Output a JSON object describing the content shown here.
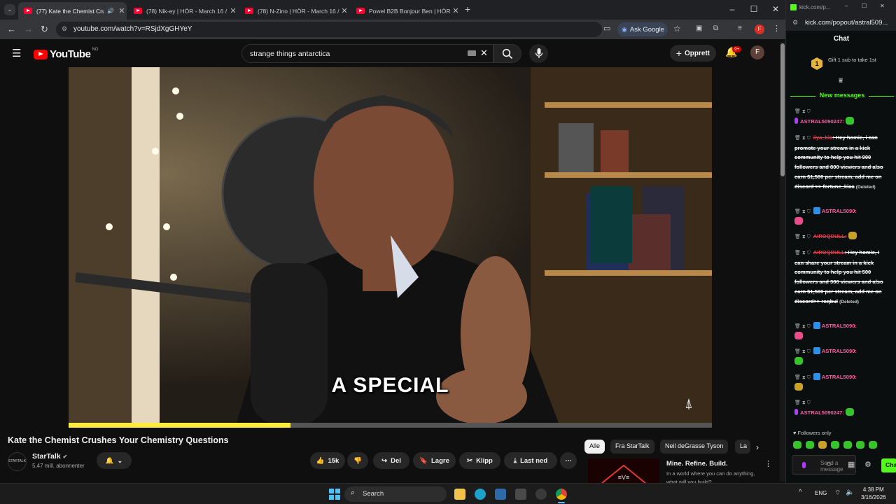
{
  "browser": {
    "tabs": [
      {
        "title": "(77) Kate the Chemist Crush",
        "active": true
      },
      {
        "title": "(78) Nik-ey | HÖR - March 16 /",
        "active": false
      },
      {
        "title": "(78) N-Zino | HÖR - March 16 /",
        "active": false
      },
      {
        "title": "Powel B2B Bonjour Ben | HÖR",
        "active": false
      }
    ],
    "url": "youtube.com/watch?v=RSjdXgGHYeY",
    "ask_google": "Ask Google",
    "profile_initial": "F"
  },
  "youtube": {
    "logo_text": "YouTube",
    "country_code": "NO",
    "search_value": "strange things antarctica",
    "create_label": "Opprett",
    "notif_count": "9+",
    "avatar_initial": "F",
    "video": {
      "caption": "A SPECIAL",
      "progress_fraction": 0.345
    },
    "title": "Kate the Chemist Crushes Your Chemistry Questions",
    "channel": {
      "logo_text": "STARTALK",
      "name": "StarTalk",
      "subscribers": "5,47 mill. abonnenter"
    },
    "actions": {
      "likes": "15k",
      "share": "Del",
      "save": "Lagre",
      "clip": "Klipp",
      "download": "Last ned"
    },
    "chips": [
      "Alle",
      "Fra StarTalk",
      "Neil deGrasse Tyson",
      "La"
    ],
    "recommendation": {
      "title": "Mine. Refine. Build.",
      "description": "In a world where you can do anything, what will you build?"
    }
  },
  "kick": {
    "window_url_short": "kick.com/p...",
    "url": "kick.com/popout/astral509...",
    "header": "Chat",
    "gift_count": "1",
    "gift_text": "Gift 1 sub to take 1st",
    "new_messages_label": "New messages",
    "messages": [
      {
        "user": "ASTRAL5090247:",
        "text": "",
        "deleted": false
      },
      {
        "user": "iiya_kia",
        "text": ": Hey homie, i can promote your stream in a kick community to help you hit 900 followers and 800 viewers and also earn $1,500 per stream, add me on discord >> fortune_kiaa",
        "deleted": true,
        "deleted_tag": "(Deleted)"
      },
      {
        "user": "ASTRAL5090:",
        "text": "",
        "deleted": false
      },
      {
        "user": "AIROQBULL:",
        "text": "",
        "deleted": false
      },
      {
        "user": "AIROQBULL",
        "text": ": Hey homie, I can share your stream in a kick community to help you hit 500 followers and 300 viewers and also earn $1,500 per stream, add me on discord>> roqbul",
        "deleted": true,
        "deleted_tag": "(Deleted)"
      },
      {
        "user": "ASTRAL5090:",
        "text": "",
        "deleted": false
      },
      {
        "user": "ASTRAL5090:",
        "text": "",
        "deleted": false
      },
      {
        "user": "ASTRAL5090:",
        "text": "",
        "deleted": false
      },
      {
        "user": "ASTRAL5090247:",
        "text": "",
        "deleted": false
      }
    ],
    "followers_only": "Followers only",
    "input_placeholder": "Send a message",
    "chat_button": "Chat"
  },
  "taskbar": {
    "search_label": "Search",
    "language": "ENG",
    "time": "4:38 PM",
    "date": "3/16/2026"
  },
  "colors": {
    "youtube_red": "#ff0000",
    "kick_green": "#53fc18",
    "progress_yellow": "#ffec3d"
  }
}
